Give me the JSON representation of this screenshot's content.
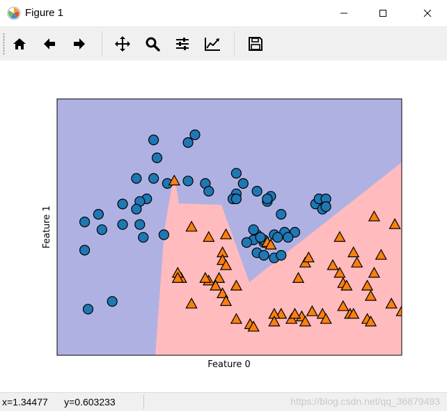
{
  "window": {
    "title": "Figure 1",
    "controls": [
      "minimize-icon",
      "maximize-icon",
      "close-icon"
    ]
  },
  "toolbar": {
    "buttons": [
      {
        "name": "home-icon"
      },
      {
        "name": "back-icon"
      },
      {
        "name": "forward-icon"
      },
      {
        "name": "pan-icon"
      },
      {
        "name": "zoom-icon"
      },
      {
        "name": "subplots-icon"
      },
      {
        "name": "edit-axes-icon"
      },
      {
        "name": "save-icon"
      }
    ]
  },
  "status": {
    "coords": "x=1.34477      y=0.603233",
    "watermark": "https://blog.csdn.net/qq_36879493"
  },
  "colors": {
    "region_class0": "#b0b1e3",
    "region_class1": "#ffbbbe",
    "class0_marker": "#1f77b4",
    "class1_marker": "#ff7f0e"
  },
  "chart_data": {
    "type": "scatter",
    "xlabel": "Feature 0",
    "ylabel": "Feature 1",
    "xlim": [
      0,
      100
    ],
    "ylim": [
      0,
      100
    ],
    "ticks": "hidden",
    "series": [
      {
        "marker": "circle",
        "points": [
          [
            28,
            84
          ],
          [
            29,
            77
          ],
          [
            38,
            83
          ],
          [
            40,
            86
          ],
          [
            23,
            69
          ],
          [
            28,
            69
          ],
          [
            32,
            67
          ],
          [
            38,
            68
          ],
          [
            43,
            67
          ],
          [
            44,
            64
          ],
          [
            52,
            71
          ],
          [
            54,
            67
          ],
          [
            52,
            63
          ],
          [
            26,
            61
          ],
          [
            24,
            60
          ],
          [
            19,
            59
          ],
          [
            12,
            55
          ],
          [
            8,
            52
          ],
          [
            13,
            49
          ],
          [
            19,
            51
          ],
          [
            24,
            51
          ],
          [
            25,
            46
          ],
          [
            31,
            47
          ],
          [
            8,
            41
          ],
          [
            51,
            61
          ],
          [
            58,
            64
          ],
          [
            61,
            60
          ],
          [
            62,
            62
          ],
          [
            58,
            47
          ],
          [
            60,
            44
          ],
          [
            57,
            45
          ],
          [
            55,
            44
          ],
          [
            58,
            40
          ],
          [
            60,
            39
          ],
          [
            63,
            38
          ],
          [
            65,
            39
          ],
          [
            66,
            48
          ],
          [
            69,
            48
          ],
          [
            67,
            46
          ],
          [
            75,
            59
          ],
          [
            76,
            61
          ],
          [
            78,
            61
          ],
          [
            61,
            61
          ],
          [
            52,
            61
          ],
          [
            63,
            47
          ],
          [
            64,
            46
          ],
          [
            60,
            45
          ],
          [
            65,
            55
          ],
          [
            57,
            49
          ],
          [
            59,
            46
          ],
          [
            77,
            57
          ],
          [
            78,
            58
          ],
          [
            9,
            18
          ],
          [
            16,
            21
          ],
          [
            23,
            57
          ]
        ],
        "label_note": ""
      },
      {
        "marker": "triangle",
        "points": [
          [
            34,
            68
          ],
          [
            39,
            50
          ],
          [
            44,
            46
          ],
          [
            49,
            47
          ],
          [
            48,
            40
          ],
          [
            48,
            37
          ],
          [
            49,
            35
          ],
          [
            47,
            30
          ],
          [
            44,
            29
          ],
          [
            43,
            30
          ],
          [
            36,
            30
          ],
          [
            35,
            32
          ],
          [
            35,
            30
          ],
          [
            39,
            20
          ],
          [
            46,
            27
          ],
          [
            48,
            24
          ],
          [
            52,
            27
          ],
          [
            49,
            21
          ],
          [
            61,
            44
          ],
          [
            62,
            43
          ],
          [
            70,
            30
          ],
          [
            72,
            36
          ],
          [
            73,
            38
          ],
          [
            80,
            35
          ],
          [
            82,
            32
          ],
          [
            83,
            28
          ],
          [
            84,
            27
          ],
          [
            90,
            27
          ],
          [
            91,
            23
          ],
          [
            86,
            40
          ],
          [
            87,
            36
          ],
          [
            92,
            32
          ],
          [
            97,
            20
          ],
          [
            100,
            17
          ],
          [
            94,
            39
          ],
          [
            83,
            19
          ],
          [
            85,
            16
          ],
          [
            86,
            16
          ],
          [
            90,
            14
          ],
          [
            91,
            13
          ],
          [
            74,
            17
          ],
          [
            77,
            16
          ],
          [
            78,
            14
          ],
          [
            71,
            15
          ],
          [
            72,
            13
          ],
          [
            68,
            14
          ],
          [
            69,
            16
          ],
          [
            65,
            16
          ],
          [
            52,
            14
          ],
          [
            56,
            12
          ],
          [
            57,
            11
          ],
          [
            63,
            16
          ],
          [
            63,
            13
          ],
          [
            82,
            46
          ],
          [
            92,
            54
          ],
          [
            98,
            51
          ]
        ],
        "label_note": ""
      }
    ]
  }
}
